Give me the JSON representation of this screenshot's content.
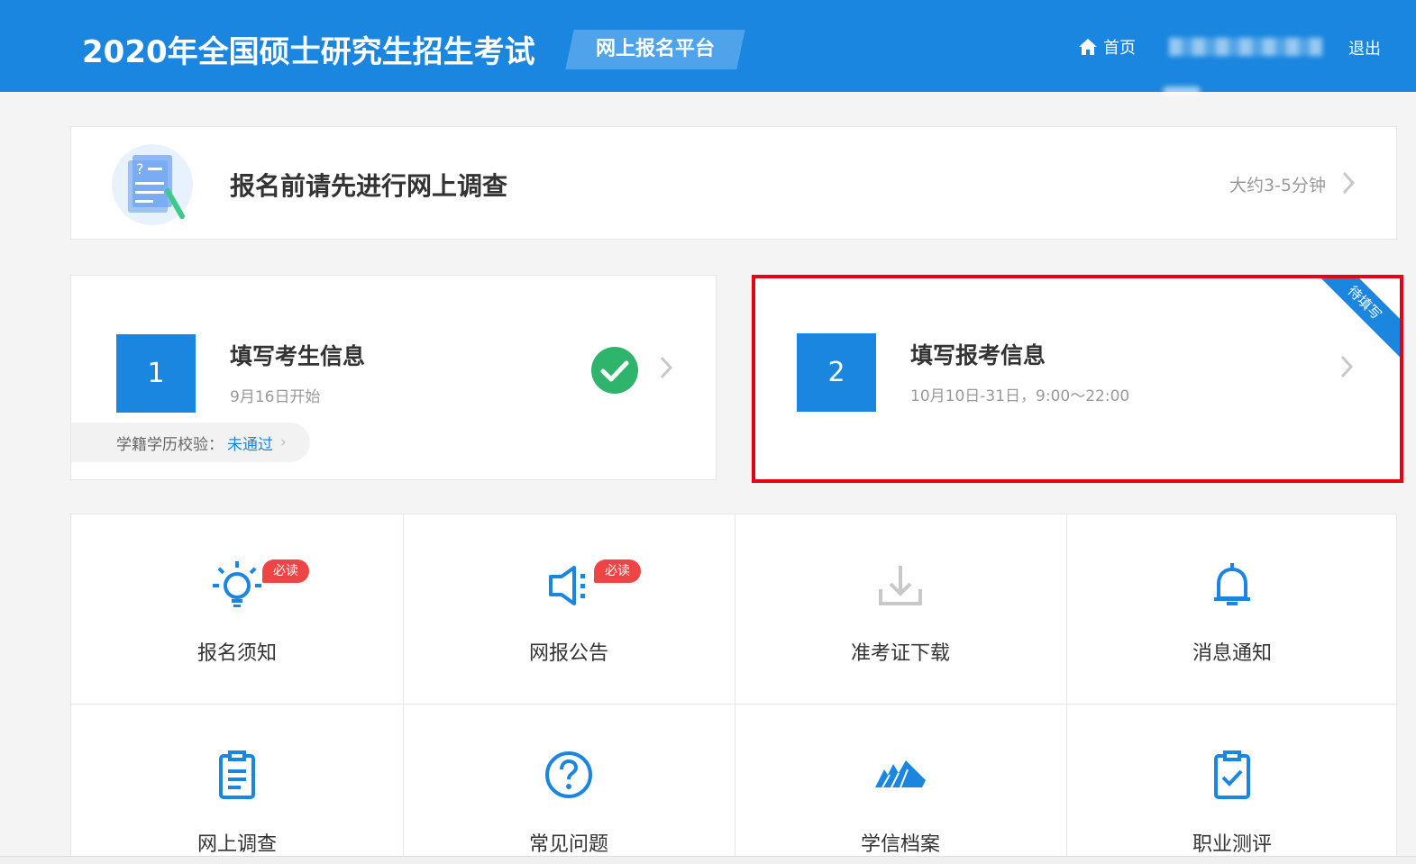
{
  "header": {
    "site_title": "2020年全国硕士研究生招生考试",
    "platform_tag": "网上报名平台",
    "home_label": "首页",
    "logout_label": "退出",
    "colors": {
      "primary": "#1a86df",
      "tag": "#4fa3ea"
    }
  },
  "survey": {
    "title": "报名前请先进行网上调查",
    "time": "大约3-5分钟"
  },
  "steps": [
    {
      "number": "1",
      "title": "填写考生信息",
      "subtitle": "9月16日开始",
      "status": "completed",
      "verify_label": "学籍学历校验：",
      "verify_status": "未通过"
    },
    {
      "number": "2",
      "title": "填写报考信息",
      "subtitle": "10月10日-31日，9:00～22:00",
      "ribbon": "待填写",
      "highlight_color": "#e60012"
    }
  ],
  "grid": {
    "items": [
      {
        "label": "报名须知",
        "icon": "lightbulb-icon",
        "badge": "必读"
      },
      {
        "label": "网报公告",
        "icon": "speaker-icon",
        "badge": "必读"
      },
      {
        "label": "准考证下载",
        "icon": "download-icon",
        "disabled": true
      },
      {
        "label": "消息通知",
        "icon": "bell-icon"
      },
      {
        "label": "网上调查",
        "icon": "clipboard-icon"
      },
      {
        "label": "常见问题",
        "icon": "question-icon"
      },
      {
        "label": "学信档案",
        "icon": "chsi-logo-icon"
      },
      {
        "label": "职业测评",
        "icon": "clipboard-check-icon"
      }
    ],
    "badge_color": "#ef4444"
  }
}
